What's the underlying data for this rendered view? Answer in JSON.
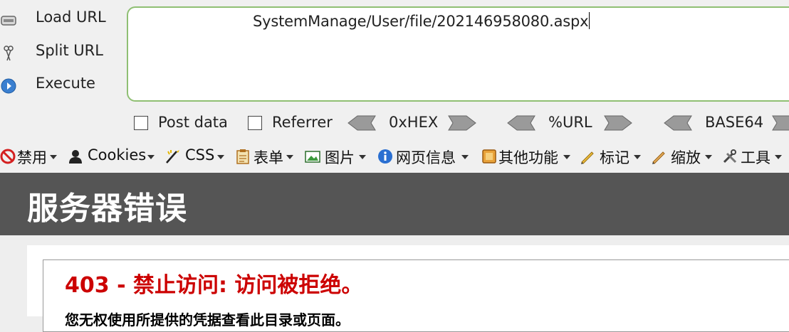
{
  "hackbar": {
    "actions": {
      "load_url": "Load URL",
      "split_url": "Split URL",
      "execute": "Execute"
    },
    "url_value": "SystemManage/User/file/202146958080.aspx",
    "options": {
      "post_data": "Post data",
      "referrer": "Referrer",
      "hex": "0xHEX",
      "url": "%URL",
      "base64": "BASE64"
    }
  },
  "toolbar": {
    "disable": "禁用",
    "cookies": "Cookies",
    "css": "CSS",
    "forms": "表单",
    "images": "图片",
    "page_info": "网页信息",
    "other": "其他功能",
    "mark": "标记",
    "zoom": "缩放",
    "tools": "工具"
  },
  "page": {
    "header_title": "服务器错误",
    "error_title": "403 - 禁止访问: 访问被拒绝。",
    "error_desc": "您无权使用所提供的凭据查看此目录或页面。"
  },
  "colors": {
    "url_border": "#8fbf73",
    "header_bg": "#555555",
    "error_red": "#cc0000"
  },
  "icons": [
    "load-url-icon",
    "split-url-icon",
    "execute-icon",
    "disable-icon",
    "cookies-icon",
    "css-icon",
    "forms-icon",
    "images-icon",
    "info-icon",
    "other-icon",
    "mark-icon",
    "zoom-icon",
    "tools-icon"
  ]
}
